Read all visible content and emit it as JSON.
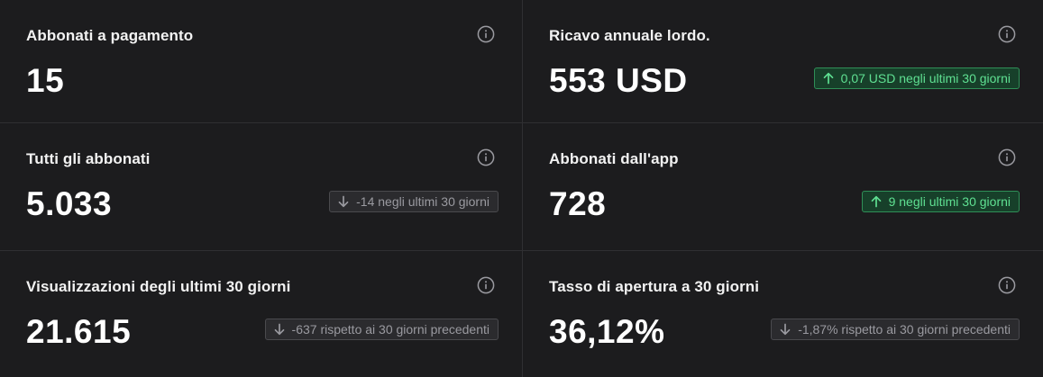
{
  "cards": [
    {
      "title": "Abbonati a pagamento",
      "value": "15",
      "info_icon": "info-circle-icon"
    },
    {
      "title": "Ricavo annuale lordo.",
      "value": "553 USD",
      "info_icon": "info-circle-icon",
      "badge": {
        "text": "0,07 USD negli ultimi 30 giorni",
        "direction": "up"
      }
    },
    {
      "title": "Tutti gli abbonati",
      "value": "5.033",
      "info_icon": "info-circle-icon",
      "badge": {
        "text": "-14 negli ultimi 30 giorni",
        "direction": "down"
      }
    },
    {
      "title": "Abbonati dall'app",
      "value": "728",
      "info_icon": "info-circle-icon",
      "badge": {
        "text": "9 negli ultimi 30 giorni",
        "direction": "up"
      }
    },
    {
      "title": "Visualizzazioni degli ultimi 30 giorni",
      "value": "21.615",
      "info_icon": "info-circle-icon",
      "badge": {
        "text": "-637 rispetto ai 30 giorni precedenti",
        "direction": "down"
      }
    },
    {
      "title": "Tasso di apertura a 30 giorni",
      "value": "36,12%",
      "info_icon": "info-circle-icon",
      "badge": {
        "text": "-1,87% rispetto ai 30 giorni precedenti",
        "direction": "down"
      }
    }
  ],
  "colors": {
    "background": "#1c1c1e",
    "divider": "#2f2f32",
    "up_text": "#5fe092",
    "up_bg": "#17402a",
    "up_border": "#2f8f57",
    "down_text": "#9a9aa0",
    "down_bg": "#2b2b2e",
    "down_border": "#4a4a4e"
  }
}
